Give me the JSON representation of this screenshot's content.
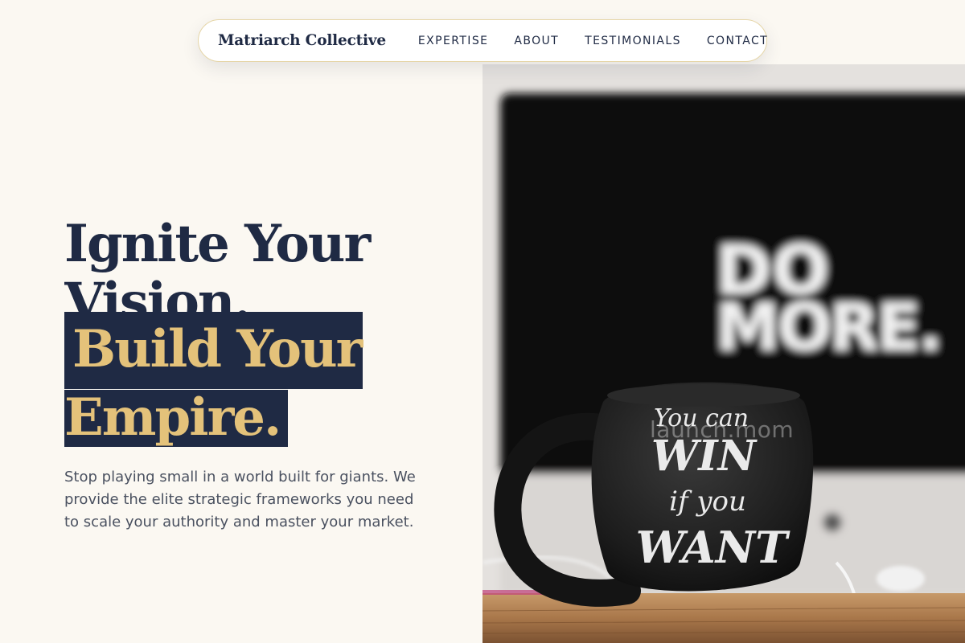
{
  "nav": {
    "brand": "Matriarch Collective",
    "links": [
      "EXPERTISE",
      "ABOUT",
      "TESTIMONIALS",
      "CONTACT"
    ]
  },
  "hero": {
    "headline_line1": "Ignite Your",
    "headline_line2": "Vision.",
    "accent_line1": "Build Your",
    "accent_line2": "Empire.",
    "subtitle": "Stop playing small in a world built for giants. We provide the elite strategic frameworks you need to scale your authority and master your market."
  },
  "image": {
    "monitor_text_1": "DO",
    "monitor_text_2": "MORE.",
    "mug_text_1": "You can",
    "mug_text_2": "WIN",
    "mug_text_3": "if you",
    "mug_text_4": "WANT",
    "watermark": "launch.mom"
  },
  "colors": {
    "background": "#fbf8f2",
    "navy": "#1f2a44",
    "gold": "#e4c27a"
  }
}
